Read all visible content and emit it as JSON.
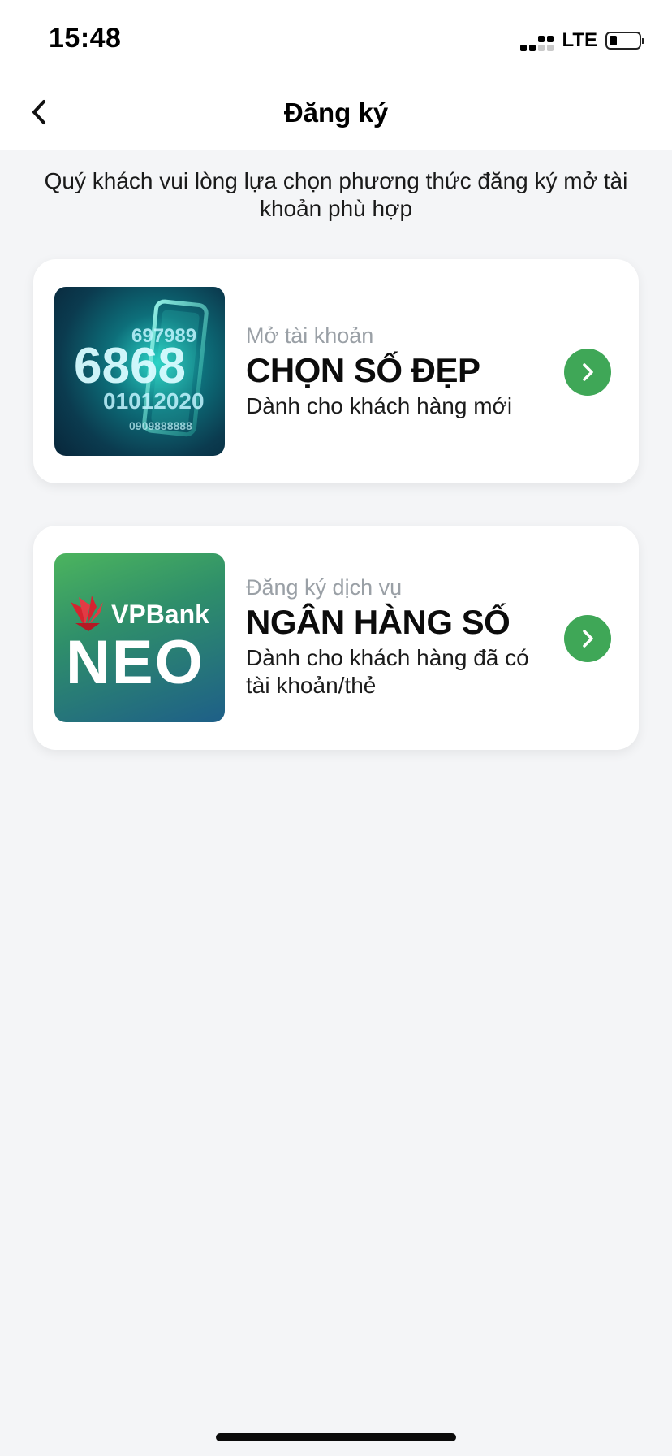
{
  "status_bar": {
    "time": "15:48",
    "network": "LTE",
    "battery_level": 0.2
  },
  "nav": {
    "title": "Đăng ký",
    "back_icon": "chevron-left-icon"
  },
  "intro_text": "Quý khách vui lòng lựa chọn phương thức đăng ký mở tài khoản phù hợp",
  "options": [
    {
      "eyebrow": "Mở tài khoản",
      "headline": "CHỌN SỐ ĐẸP",
      "subtitle": "Dành cho khách hàng mới",
      "image_numbers": [
        "697989",
        "6868",
        "01012020",
        "0909888888"
      ],
      "icon": "chevron-right-icon"
    },
    {
      "eyebrow": "Đăng ký dịch vụ",
      "headline": "NGÂN HÀNG SỐ",
      "subtitle": "Dành cho khách hàng đã có tài khoản/thẻ",
      "logo_text": "VPBank",
      "logo_product": "NEO",
      "icon": "chevron-right-icon"
    }
  ],
  "colors": {
    "accent_green": "#3fa757",
    "background": "#f4f5f7",
    "logo_red": "#d6232f"
  }
}
